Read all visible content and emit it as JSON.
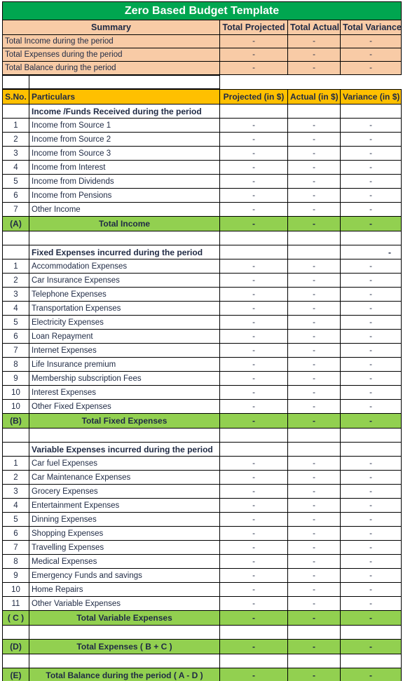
{
  "document": {
    "title": "Zero Based Budget Template"
  },
  "colors": {
    "title_bg": "#00A650",
    "title_text": "#FFFFFF",
    "summary_bg": "#F8CBA6",
    "header_bg": "#FFC000",
    "total_bg": "#92D050",
    "border": "#000000",
    "text": "#1F2A44"
  },
  "summary": {
    "label": "Summary",
    "columns": [
      "Total Projected",
      "Total Actual",
      "Total Variance"
    ],
    "rows": [
      {
        "label": "Total Income during the period",
        "projected": "-",
        "actual": "-",
        "variance": "-"
      },
      {
        "label": "Total Expenses during the period",
        "projected": "-",
        "actual": "-",
        "variance": "-"
      },
      {
        "label": "Total Balance during the period",
        "projected": "-",
        "actual": "-",
        "variance": "-"
      }
    ]
  },
  "table": {
    "headers": {
      "sno": "S.No.",
      "particulars": "Particulars",
      "projected": "Projected (in $)",
      "actual": "Actual (in $)",
      "variance": "Variance (in $)"
    },
    "income": {
      "section_title": "Income /Funds Received during the period",
      "section_projected": "",
      "section_actual": "",
      "section_variance": "",
      "items": [
        {
          "sno": "1",
          "label": "Income from Source 1",
          "projected": "-",
          "actual": "-",
          "variance": "-"
        },
        {
          "sno": "2",
          "label": "Income from Source 2",
          "projected": "-",
          "actual": "-",
          "variance": "-"
        },
        {
          "sno": "3",
          "label": "Income from Source 3",
          "projected": "-",
          "actual": "-",
          "variance": "-"
        },
        {
          "sno": "4",
          "label": "Income from Interest",
          "projected": "-",
          "actual": "-",
          "variance": "-"
        },
        {
          "sno": "5",
          "label": "Income from Dividends",
          "projected": "-",
          "actual": "-",
          "variance": "-"
        },
        {
          "sno": "6",
          "label": "Income from Pensions",
          "projected": "-",
          "actual": "-",
          "variance": "-"
        },
        {
          "sno": "7",
          "label": "Other Income",
          "projected": "-",
          "actual": "-",
          "variance": "-"
        }
      ],
      "total": {
        "sno": "(A)",
        "label": "Total Income",
        "projected": "-",
        "actual": "-",
        "variance": "-"
      }
    },
    "fixed_expenses": {
      "section_title": "Fixed Expenses incurred during the period",
      "section_projected": "",
      "section_actual": "",
      "section_variance": "-",
      "items": [
        {
          "sno": "1",
          "label": "Accommodation Expenses",
          "projected": "-",
          "actual": "-",
          "variance": "-"
        },
        {
          "sno": "2",
          "label": "Car Insurance Expenses",
          "projected": "-",
          "actual": "-",
          "variance": "-"
        },
        {
          "sno": "3",
          "label": "Telephone Expenses",
          "projected": "-",
          "actual": "-",
          "variance": "-"
        },
        {
          "sno": "4",
          "label": "Transportation Expenses",
          "projected": "-",
          "actual": "-",
          "variance": "-"
        },
        {
          "sno": "5",
          "label": "Electricity Expenses",
          "projected": "-",
          "actual": "-",
          "variance": "-"
        },
        {
          "sno": "6",
          "label": "Loan Repayment",
          "projected": "-",
          "actual": "-",
          "variance": "-"
        },
        {
          "sno": "7",
          "label": "Internet Expenses",
          "projected": "-",
          "actual": "-",
          "variance": "-"
        },
        {
          "sno": "8",
          "label": "Life Insurance premium",
          "projected": "-",
          "actual": "-",
          "variance": "-"
        },
        {
          "sno": "9",
          "label": "Membership subscription Fees",
          "projected": "-",
          "actual": "-",
          "variance": "-"
        },
        {
          "sno": "10",
          "label": "Interest Expenses",
          "projected": "-",
          "actual": "-",
          "variance": "-"
        },
        {
          "sno": "10",
          "label": "Other Fixed Expenses",
          "projected": "-",
          "actual": "-",
          "variance": "-"
        }
      ],
      "total": {
        "sno": "(B)",
        "label": "Total Fixed Expenses",
        "projected": "-",
        "actual": "-",
        "variance": "-"
      }
    },
    "variable_expenses": {
      "section_title": "Variable Expenses incurred during the period",
      "section_projected": "",
      "section_actual": "",
      "section_variance": "",
      "items": [
        {
          "sno": "1",
          "label": "Car fuel Expenses",
          "projected": "-",
          "actual": "-",
          "variance": "-"
        },
        {
          "sno": "2",
          "label": "Car Maintenance Expenses",
          "projected": "-",
          "actual": "-",
          "variance": "-"
        },
        {
          "sno": "3",
          "label": "Grocery Expenses",
          "projected": "-",
          "actual": "-",
          "variance": "-"
        },
        {
          "sno": "4",
          "label": "Entertainment Expenses",
          "projected": "-",
          "actual": "-",
          "variance": "-"
        },
        {
          "sno": "5",
          "label": "Dinning Expenses",
          "projected": "-",
          "actual": "-",
          "variance": "-"
        },
        {
          "sno": "6",
          "label": "Shopping Expenses",
          "projected": "-",
          "actual": "-",
          "variance": "-"
        },
        {
          "sno": "7",
          "label": "Travelling Expenses",
          "projected": "-",
          "actual": "-",
          "variance": "-"
        },
        {
          "sno": "8",
          "label": "Medical Expenses",
          "projected": "-",
          "actual": "-",
          "variance": "-"
        },
        {
          "sno": "9",
          "label": "Emergency Funds and savings",
          "projected": "-",
          "actual": "-",
          "variance": "-"
        },
        {
          "sno": "10",
          "label": "Home Repairs",
          "projected": "-",
          "actual": "-",
          "variance": "-"
        },
        {
          "sno": "11",
          "label": "Other Variable Expenses",
          "projected": "-",
          "actual": "-",
          "variance": "-"
        }
      ],
      "total": {
        "sno": "( C )",
        "label": "Total Variable Expenses",
        "projected": "-",
        "actual": "-",
        "variance": "-"
      }
    },
    "grand_totals": [
      {
        "sno": "(D)",
        "label": "Total Expenses ( B + C )",
        "projected": "-",
        "actual": "-",
        "variance": "-"
      },
      {
        "sno": "(E)",
        "label": "Total Balance during the period ( A - D )",
        "projected": "-",
        "actual": "-",
        "variance": "-"
      }
    ]
  }
}
